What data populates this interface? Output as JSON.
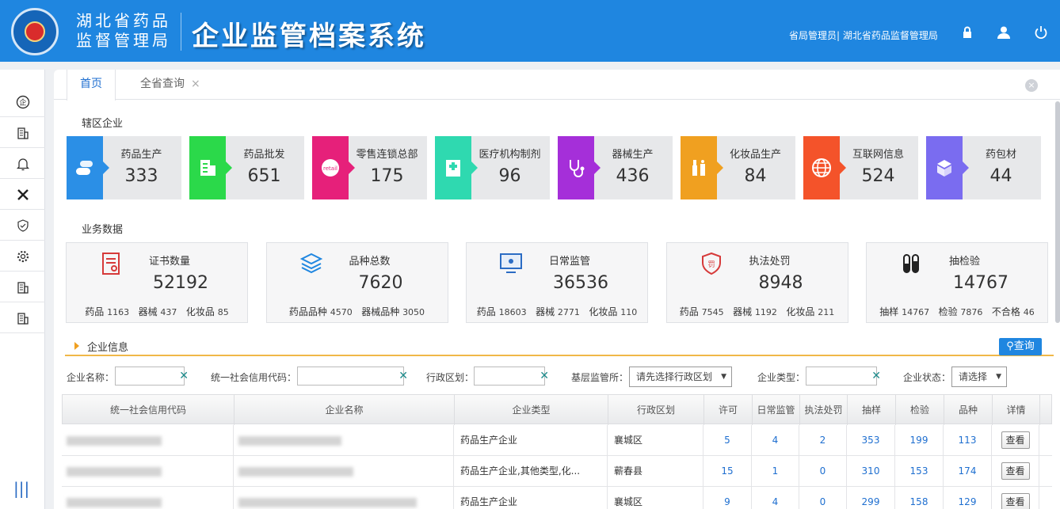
{
  "header": {
    "org_line1": "湖北省药品",
    "org_line2": "监督管理局",
    "system_title": "企业监管档案系统",
    "user_info": "省局管理员| 湖北省药品监督管理局"
  },
  "tabs": [
    {
      "label": "首页"
    },
    {
      "label": "全省查询"
    }
  ],
  "jurisdiction": {
    "title": "辖区企业",
    "cards": [
      {
        "label": "药品生产",
        "value": "333",
        "color": "#2b8fe6",
        "icon": "pill-icon"
      },
      {
        "label": "药品批发",
        "value": "651",
        "color": "#2bd94a",
        "icon": "building-icon"
      },
      {
        "label": "零售连锁总部",
        "value": "175",
        "color": "#e6207a",
        "icon": "retail-badge-icon"
      },
      {
        "label": "医疗机构制剂",
        "value": "96",
        "color": "#2fd9b0",
        "icon": "hospital-icon"
      },
      {
        "label": "器械生产",
        "value": "436",
        "color": "#a52fd9",
        "icon": "stethoscope-icon"
      },
      {
        "label": "化妆品生产",
        "value": "84",
        "color": "#f0a020",
        "icon": "cosmetics-icon"
      },
      {
        "label": "互联网信息",
        "value": "524",
        "color": "#f4532a",
        "icon": "globe-icon"
      },
      {
        "label": "药包材",
        "value": "44",
        "color": "#7a6cf0",
        "icon": "package-icon"
      }
    ]
  },
  "business": {
    "title": "业务数据",
    "cards": [
      {
        "label": "证书数量",
        "value": "52192",
        "icon": "certificate-icon",
        "sub": [
          [
            "药品",
            "1163"
          ],
          [
            "器械",
            "437"
          ],
          [
            "化妆品",
            "85"
          ]
        ]
      },
      {
        "label": "品种总数",
        "value": "7620",
        "icon": "layers-icon",
        "sub": [
          [
            "药品品种",
            "4570"
          ],
          [
            "器械品种",
            "3050"
          ]
        ]
      },
      {
        "label": "日常监管",
        "value": "36536",
        "icon": "monitor-icon",
        "sub": [
          [
            "药品",
            "18603"
          ],
          [
            "器械",
            "2771"
          ],
          [
            "化妆品",
            "110"
          ]
        ]
      },
      {
        "label": "执法处罚",
        "value": "8948",
        "icon": "penalty-shield-icon",
        "sub": [
          [
            "药品",
            "7545"
          ],
          [
            "器械",
            "1192"
          ],
          [
            "化妆品",
            "211"
          ]
        ]
      },
      {
        "label": "抽检验",
        "value": "14767",
        "icon": "test-tubes-icon",
        "sub": [
          [
            "抽样",
            "14767"
          ],
          [
            "检验",
            "7876"
          ],
          [
            "不合格",
            "46"
          ]
        ]
      }
    ]
  },
  "company_info": {
    "title": "企业信息",
    "query_button": "查询",
    "filters": {
      "name_label": "企业名称：",
      "credit_label": "统一社会信用代码：",
      "region_label": "行政区划：",
      "grassroots_label": "基层监管所：",
      "grassroots_value": "请先选择行政区划",
      "type_label": "企业类型：",
      "status_label": "企业状态：",
      "status_value": "请选择"
    },
    "columns": [
      "统一社会信用代码",
      "企业名称",
      "企业类型",
      "行政区划",
      "许可",
      "日常监管",
      "执法处罚",
      "抽样",
      "检验",
      "品种",
      "详情"
    ],
    "rows": [
      {
        "type": "药品生产企业",
        "region": "襄城区",
        "license": "5",
        "daily": "4",
        "penalty": "2",
        "sample": "353",
        "inspect": "199",
        "variety": "113",
        "action": "查看"
      },
      {
        "type": "药品生产企业,其他类型,化...",
        "region": "蕲春县",
        "license": "15",
        "daily": "1",
        "penalty": "0",
        "sample": "310",
        "inspect": "153",
        "variety": "174",
        "action": "查看"
      },
      {
        "type": "药品生产企业",
        "region": "襄城区",
        "license": "9",
        "daily": "4",
        "penalty": "0",
        "sample": "299",
        "inspect": "158",
        "variety": "129",
        "action": "查看"
      }
    ]
  }
}
